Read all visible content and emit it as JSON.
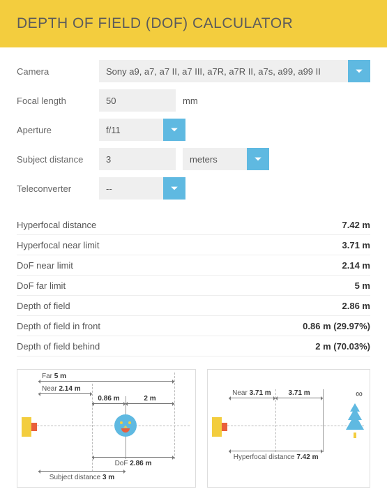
{
  "header": {
    "title": "DEPTH OF FIELD (DOF) CALCULATOR"
  },
  "form": {
    "camera": {
      "label": "Camera",
      "value": "Sony a9, a7, a7 II, a7 III, a7R, a7R II, a7s, a99, a99 II"
    },
    "focal": {
      "label": "Focal length",
      "value": "50",
      "unit": "mm"
    },
    "aperture": {
      "label": "Aperture",
      "value": "f/11"
    },
    "distance": {
      "label": "Subject distance",
      "value": "3",
      "unit": "meters"
    },
    "tele": {
      "label": "Teleconverter",
      "value": "--"
    }
  },
  "results": [
    {
      "k": "Hyperfocal distance",
      "v": "7.42 m"
    },
    {
      "k": "Hyperfocal near limit",
      "v": "3.71 m"
    },
    {
      "k": "DoF near limit",
      "v": "2.14 m"
    },
    {
      "k": "DoF far limit",
      "v": "5 m"
    },
    {
      "k": "Depth of field",
      "v": "2.86 m"
    },
    {
      "k": "Depth of field in front",
      "v": "0.86 m (29.97%)"
    },
    {
      "k": "Depth of field behind",
      "v": "2 m (70.03%)"
    }
  ],
  "diag1": {
    "far_label": "Far",
    "far_val": "5 m",
    "near_label": "Near",
    "near_val": "2.14 m",
    "front_val": "0.86 m",
    "behind_val": "2 m",
    "dof_label": "DoF",
    "dof_val": "2.86 m",
    "subj_label": "Subject distance",
    "subj_val": "3 m"
  },
  "diag2": {
    "near_label": "Near",
    "near_val": "3.71 m",
    "half_val": "3.71 m",
    "inf": "∞",
    "hyper_label": "Hyperfocal distance",
    "hyper_val": "7.42 m"
  }
}
